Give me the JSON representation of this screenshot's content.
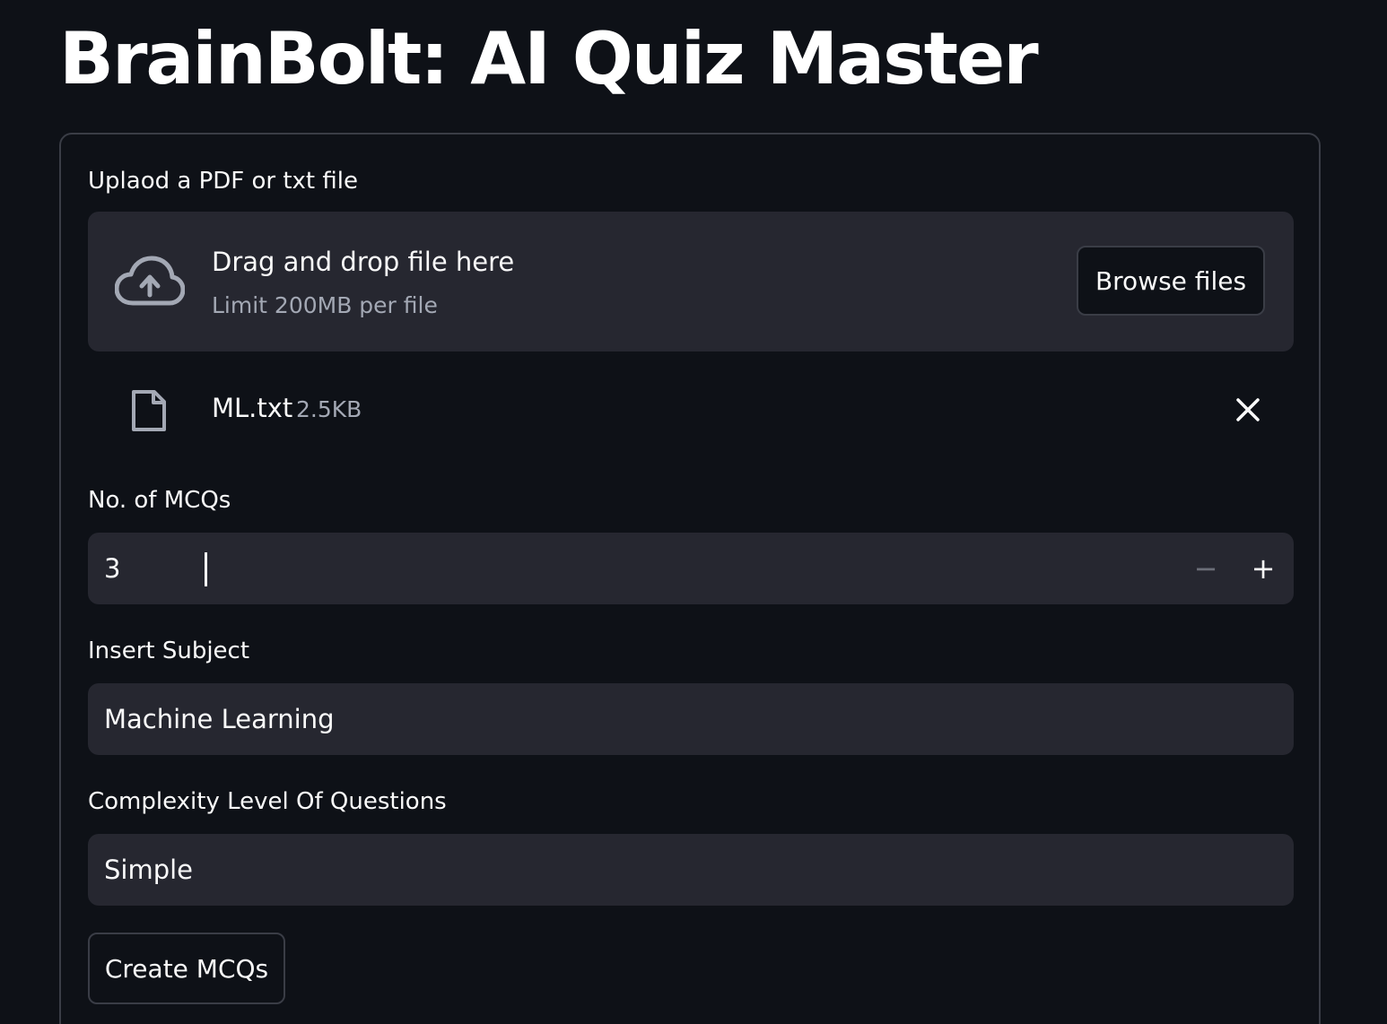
{
  "header": {
    "title": "BrainBolt: AI Quiz Master"
  },
  "uploader": {
    "label": "Uplaod a PDF or txt file",
    "dropzone_title": "Drag and drop file here",
    "dropzone_limit": "Limit 200MB per file",
    "browse_label": "Browse files",
    "upload_icon": "cloud-upload-icon",
    "file": {
      "name": "ML.txt",
      "size": "2.5KB",
      "icon": "file-icon",
      "remove_icon": "close-icon"
    }
  },
  "mcq_count": {
    "label": "No. of MCQs",
    "value": "3",
    "decrement_symbol": "−",
    "increment_symbol": "+"
  },
  "subject": {
    "label": "Insert Subject",
    "value": "Machine Learning"
  },
  "complexity": {
    "label": "Complexity Level Of Questions",
    "value": "Simple"
  },
  "actions": {
    "create_label": "Create MCQs"
  },
  "colors": {
    "background": "#0e1117",
    "input_background": "#262730",
    "border": "#3a3d46",
    "text": "#fafafa",
    "muted_text": "#a3a8b4"
  }
}
